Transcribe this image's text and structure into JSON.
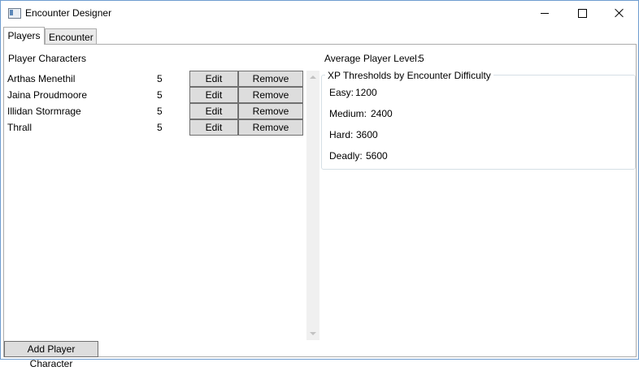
{
  "window": {
    "title": "Encounter Designer"
  },
  "tabs": [
    "Players",
    "Encounter"
  ],
  "players": {
    "section_label": "Player Characters",
    "rows": [
      {
        "name": "Arthas Menethil",
        "level": "5"
      },
      {
        "name": "Jaina Proudmoore",
        "level": "5"
      },
      {
        "name": "Illidan Stormrage",
        "level": "5"
      },
      {
        "name": "Thrall",
        "level": "5"
      }
    ],
    "edit_label": "Edit",
    "remove_label": "Remove",
    "add_label": "Add Player Character"
  },
  "summary": {
    "avg_label": "Average Player Level:",
    "avg_value": "5",
    "group_title": "XP Thresholds by Encounter Difficulty",
    "thresholds": [
      {
        "label": "Easy:",
        "value": "1200"
      },
      {
        "label": "Medium:",
        "value": "2400"
      },
      {
        "label": "Hard:",
        "value": "3600"
      },
      {
        "label": "Deadly:",
        "value": "5600"
      }
    ]
  }
}
